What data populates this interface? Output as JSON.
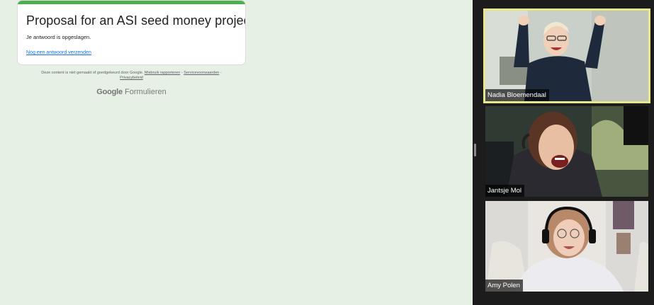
{
  "form": {
    "title": "Proposal for an ASI seed money project",
    "confirmation": "Je antwoord is opgeslagen.",
    "resubmit_link": "Nog een antwoord verzenden",
    "accent_color": "#4caf50"
  },
  "footer": {
    "disclaimer": "Deze content is niet gemaakt of goedgekeurd door Google.",
    "report_link": "Misbruik rapporteren",
    "separator": "-",
    "terms_link": "Servicevoorwaarden",
    "privacy_link": "Privacybeleid",
    "brand_google": "Google",
    "brand_product": "Formulieren"
  },
  "participants": [
    {
      "name": "Nadia Bloemendaal",
      "active_speaker": true,
      "highlight_color": "#e6e88a"
    },
    {
      "name": "Jantsje Mol",
      "active_speaker": false
    },
    {
      "name": "Amy Polen",
      "active_speaker": false
    }
  ]
}
